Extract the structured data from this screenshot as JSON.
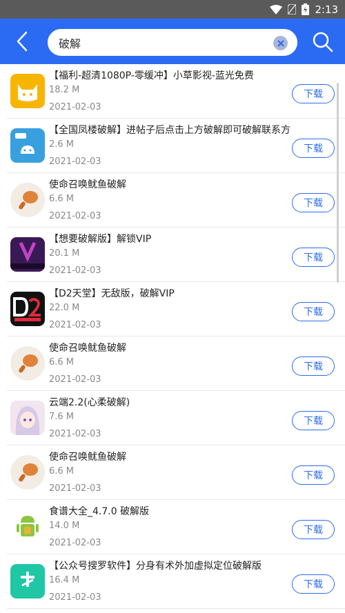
{
  "status": {
    "time": "2:13"
  },
  "search": {
    "value": "破解",
    "placeholder": ""
  },
  "icons": {
    "back": "back-arrow-icon",
    "clear": "clear-icon",
    "search": "search-icon"
  },
  "colors": {
    "accent": "#2b6bf3",
    "statusbar": "#5a5a5a"
  },
  "items": [
    {
      "title": "【福利-超清1080P-零缓冲】小草影视-蓝光免费",
      "size": "18.2 M",
      "date": "2021-02-03",
      "button": "下载",
      "icon": "cat-app-icon"
    },
    {
      "title": "【全国凤楼破解】进帖子后点击上方破解即可破解联系方",
      "size": "2.6 M",
      "date": "2021-02-03",
      "button": "下载",
      "icon": "android-apk-icon"
    },
    {
      "title": "使命召唤鱿鱼破解",
      "size": "6.6 M",
      "date": "2021-02-03",
      "button": "下载",
      "icon": "drumstick-icon"
    },
    {
      "title": "【想要破解版】解锁VIP",
      "size": "20.1 M",
      "date": "2021-02-03",
      "button": "下载",
      "icon": "xy-app-icon"
    },
    {
      "title": "【D2天堂】无敌版，破解VIP",
      "size": "22.0 M",
      "date": "2021-02-03",
      "button": "下载",
      "icon": "d2-app-icon"
    },
    {
      "title": "使命召唤鱿鱼破解",
      "size": "6.6 M",
      "date": "2021-02-03",
      "button": "下载",
      "icon": "drumstick-icon"
    },
    {
      "title": "云端2.2(心柔破解)",
      "size": "7.6 M",
      "date": "2021-02-03",
      "button": "下载",
      "icon": "anime-girl-icon"
    },
    {
      "title": "使命召唤鱿鱼破解",
      "size": "6.6 M",
      "date": "2021-02-03",
      "button": "下载",
      "icon": "drumstick-icon"
    },
    {
      "title": "食谱大全_4.7.0 破解版",
      "size": "14.0 M",
      "date": "2021-02-03",
      "button": "下载",
      "icon": "android-robot-icon"
    },
    {
      "title": "【公众号搜罗软件】分身有术外加虚拟定位破解版",
      "size": "16.4 M",
      "date": "2021-02-03",
      "button": "下载",
      "icon": "split-app-icon"
    }
  ]
}
